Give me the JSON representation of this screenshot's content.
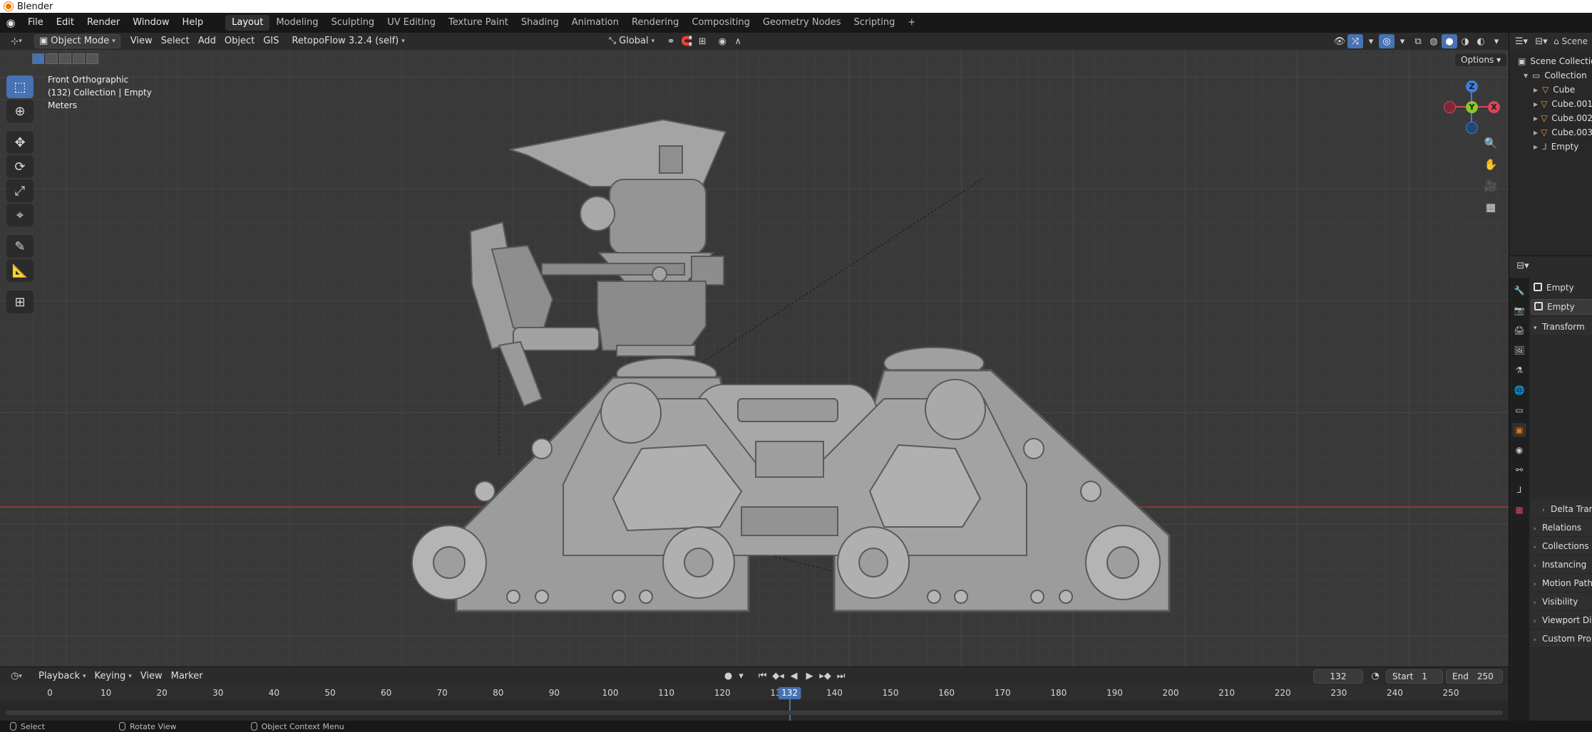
{
  "window": {
    "title": "Blender"
  },
  "menu": [
    "File",
    "Edit",
    "Render",
    "Window",
    "Help"
  ],
  "workspaces": [
    "Layout",
    "Modeling",
    "Sculpting",
    "UV Editing",
    "Texture Paint",
    "Shading",
    "Animation",
    "Rendering",
    "Compositing",
    "Geometry Nodes",
    "Scripting"
  ],
  "workspace_add": "+",
  "viewport_header": {
    "mode": "Object Mode",
    "menus": [
      "View",
      "Select",
      "Add",
      "Object",
      "GIS"
    ],
    "addon": "RetopoFlow 3.2.4 (self)",
    "orientation": "Global"
  },
  "viewport": {
    "info": [
      "Front Orthographic",
      "(132) Collection | Empty",
      "Meters"
    ],
    "options_label": "Options",
    "gizmo": {
      "z": "Z",
      "y": "Y",
      "x": "X"
    }
  },
  "outliner": {
    "rows": [
      {
        "label": "Scene Collection",
        "indent": 0
      },
      {
        "label": "Collection",
        "indent": 1
      },
      {
        "label": "Cube",
        "indent": 2,
        "icon": "mesh"
      },
      {
        "label": "Cube.001",
        "indent": 2,
        "icon": "mesh"
      },
      {
        "label": "Cube.002",
        "indent": 2,
        "icon": "mesh"
      },
      {
        "label": "Cube.003",
        "indent": 2,
        "icon": "mesh"
      },
      {
        "label": "Empty",
        "indent": 2,
        "icon": "empty"
      }
    ],
    "scene_label": "Scene"
  },
  "properties": {
    "object_name": "Empty",
    "data_name": "Empty",
    "panels": [
      "Transform",
      "Delta Transform",
      "Relations",
      "Collections",
      "Instancing",
      "Motion Paths",
      "Visibility",
      "Viewport Display",
      "Custom Properties"
    ]
  },
  "timeline": {
    "menus": [
      "Playback",
      "Keying",
      "View",
      "Marker"
    ],
    "current_frame": "132",
    "start_label": "Start",
    "start": "1",
    "end_label": "End",
    "end": "250",
    "ticks": [
      0,
      10,
      20,
      30,
      40,
      50,
      60,
      70,
      80,
      90,
      100,
      110,
      120,
      130,
      140,
      150,
      160,
      170,
      180,
      190,
      200,
      210,
      220,
      230,
      240,
      250
    ]
  },
  "status": [
    "Select",
    "Rotate View",
    "Object Context Menu"
  ],
  "colors": {
    "accent": "#4772b3",
    "x_axis": "#d8465c",
    "y_axis": "#8ac926",
    "z_axis": "#3d7ee0",
    "object": "#ea7600"
  }
}
